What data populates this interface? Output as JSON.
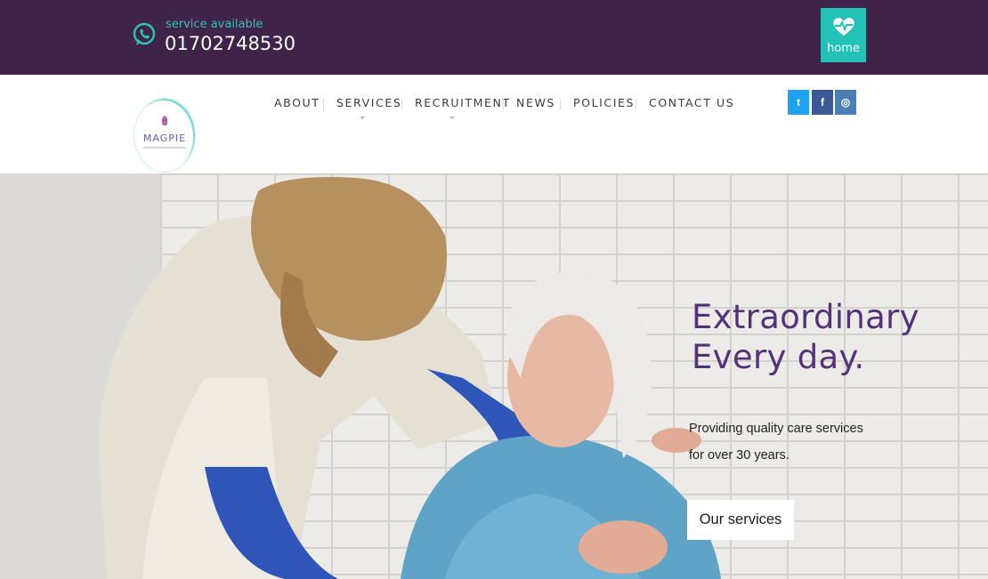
{
  "topbar": {
    "whatsapp_icon": "whatsapp-icon",
    "service_label": "service available",
    "phone": "01702748530",
    "home_button": {
      "label": "home",
      "icon": "heart-pulse-icon"
    },
    "colors": {
      "background": "#3f2349",
      "accent": "#24c2b6"
    }
  },
  "header": {
    "logo": {
      "text": "MAGPIE"
    },
    "nav": [
      {
        "label": "ABOUT"
      },
      {
        "label": "SERVICES"
      },
      {
        "label": "RECRUITMENT"
      },
      {
        "label": "NEWS"
      },
      {
        "label": "POLICIES"
      },
      {
        "label": "CONTACT US"
      }
    ],
    "social": [
      {
        "name": "twitter-icon",
        "glyph": "t",
        "color": "#1da1f2"
      },
      {
        "name": "facebook-icon",
        "glyph": "f",
        "color": "#3b5998"
      },
      {
        "name": "instagram-icon",
        "glyph": "◎",
        "color": "#4a7fb5"
      }
    ]
  },
  "hero": {
    "title_line1": "Extraordinary",
    "title_line2": "Every day.",
    "subtitle_line1": "Providing quality care services",
    "subtitle_line2": "for over 30 years.",
    "cta_label": "Our services",
    "colors": {
      "title": "#54327a"
    }
  }
}
